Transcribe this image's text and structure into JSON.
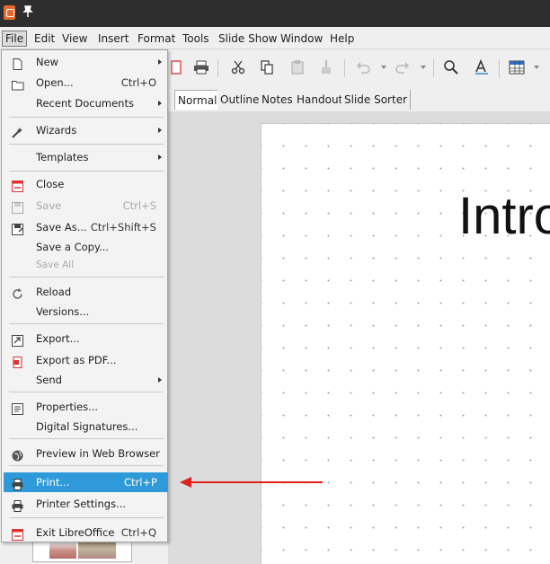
{
  "menubar": {
    "items": [
      "File",
      "Edit",
      "View",
      "Insert",
      "Format",
      "Tools",
      "Slide Show",
      "Window",
      "Help"
    ]
  },
  "tabs": [
    "Normal",
    "Outline",
    "Notes",
    "Handout",
    "Slide Sorter"
  ],
  "slide": {
    "title": "Intro"
  },
  "file_menu": {
    "new": "New",
    "open": "Open...",
    "open_sc": "Ctrl+O",
    "recent": "Recent Documents",
    "wizards": "Wizards",
    "templates": "Templates",
    "close": "Close",
    "save": "Save",
    "save_sc": "Ctrl+S",
    "save_as": "Save As...",
    "save_as_sc": "Ctrl+Shift+S",
    "save_copy": "Save a Copy...",
    "save_all": "Save All",
    "reload": "Reload",
    "versions": "Versions...",
    "export": "Export...",
    "export_pdf": "Export as PDF...",
    "send": "Send",
    "properties": "Properties...",
    "digital_signatures": "Digital Signatures...",
    "preview_web": "Preview in Web Browser",
    "print": "Print...",
    "print_sc": "Ctrl+P",
    "printer_settings": "Printer Settings...",
    "exit": "Exit LibreOffice",
    "exit_sc": "Ctrl+Q"
  },
  "colors": {
    "highlight": "#2f9ad9",
    "annotation": "#e02020",
    "titlebar": "#2e2e2e"
  }
}
